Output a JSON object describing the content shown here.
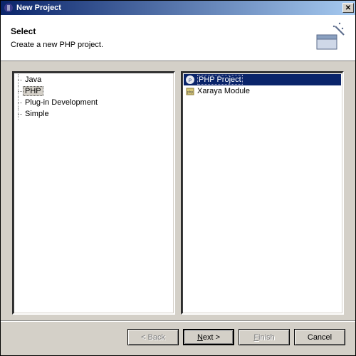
{
  "window": {
    "title": "New Project"
  },
  "header": {
    "title": "Select",
    "subtitle": "Create a new PHP project."
  },
  "categories": [
    {
      "label": "Java",
      "selected": false
    },
    {
      "label": "PHP",
      "selected": true
    },
    {
      "label": "Plug-in Development",
      "selected": false
    },
    {
      "label": "Simple",
      "selected": false
    }
  ],
  "wizards": [
    {
      "label": "PHP Project",
      "icon": "php-project-icon",
      "selected": true
    },
    {
      "label": "Xaraya Module",
      "icon": "module-icon",
      "selected": false
    }
  ],
  "buttons": {
    "back": "< Back",
    "next": "Next >",
    "finish": "Finish",
    "cancel": "Cancel"
  }
}
